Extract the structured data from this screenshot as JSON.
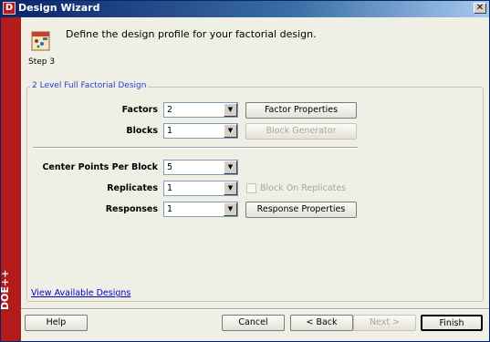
{
  "window": {
    "title": "Design Wizard",
    "close_glyph": "✕",
    "logo_letter": "D",
    "side_brand": "DOE++"
  },
  "header": {
    "description": "Define the design profile for your factorial design.",
    "step": "Step 3"
  },
  "group": {
    "title": "2 Level Full Factorial Design",
    "factors": {
      "label": "Factors",
      "value": "2",
      "button": "Factor Properties"
    },
    "blocks": {
      "label": "Blocks",
      "value": "1",
      "button": "Block Generator"
    },
    "center_points": {
      "label": "Center Points Per Block",
      "value": "5"
    },
    "replicates": {
      "label": "Replicates",
      "value": "1",
      "checkbox_label": "Block On Replicates"
    },
    "responses": {
      "label": "Responses",
      "value": "1",
      "button": "Response Properties"
    }
  },
  "link": {
    "label": "View Available Designs"
  },
  "buttons": {
    "help": "Help",
    "cancel": "Cancel",
    "back": "< Back",
    "next": "Next >",
    "finish": "Finish"
  },
  "icons": {
    "combo_arrow": "▼",
    "header": "design-wizard-icon",
    "accent": "#b31b1b"
  }
}
